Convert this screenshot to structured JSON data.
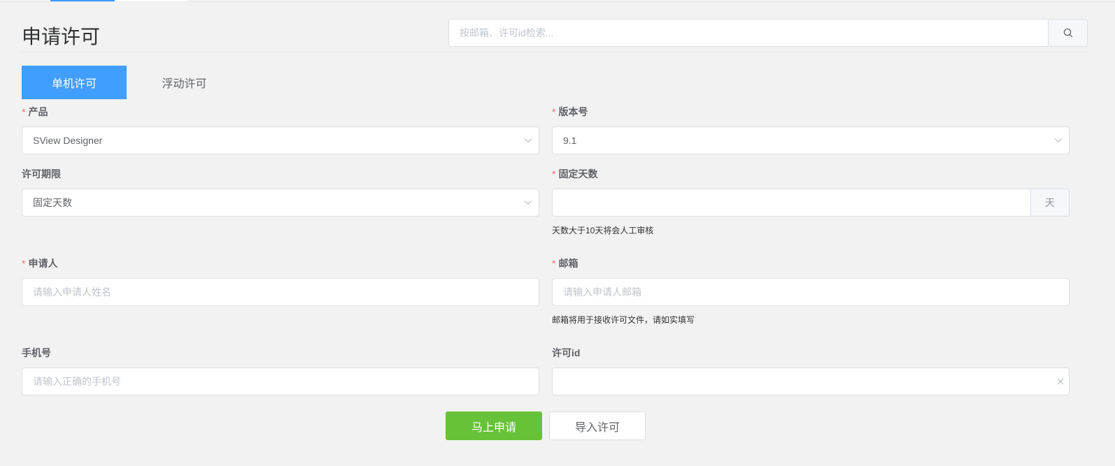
{
  "header": {
    "title": "申请许可",
    "search_placeholder": "按邮箱、许可id检索..."
  },
  "tabs": [
    {
      "label": "单机许可",
      "active": true
    },
    {
      "label": "浮动许可",
      "active": false
    }
  ],
  "form": {
    "product": {
      "label": "产品",
      "required": true,
      "value": "SView Designer"
    },
    "version": {
      "label": "版本号",
      "required": true,
      "value": "9.1"
    },
    "period": {
      "label": "许可期限",
      "required": false,
      "value": "固定天数"
    },
    "fixed_days": {
      "label": "固定天数",
      "required": true,
      "value": "",
      "unit": "天",
      "hint": "天数大于10天将会人工审核"
    },
    "applicant": {
      "label": "申请人",
      "required": true,
      "placeholder": "请输入申请人姓名"
    },
    "email": {
      "label": "邮箱",
      "required": true,
      "placeholder": "请输入申请人邮箱",
      "hint": "邮箱将用于接收许可文件，请如实填写"
    },
    "phone": {
      "label": "手机号",
      "required": false,
      "placeholder": "请输入正确的手机号"
    },
    "license_id": {
      "label": "许可id",
      "required": false,
      "value": ""
    }
  },
  "actions": {
    "submit_label": "马上申请",
    "import_label": "导入许可"
  },
  "colors": {
    "primary": "#409eff",
    "success": "#67c23a",
    "required": "#f56c6c",
    "background": "#f2f2f2"
  }
}
